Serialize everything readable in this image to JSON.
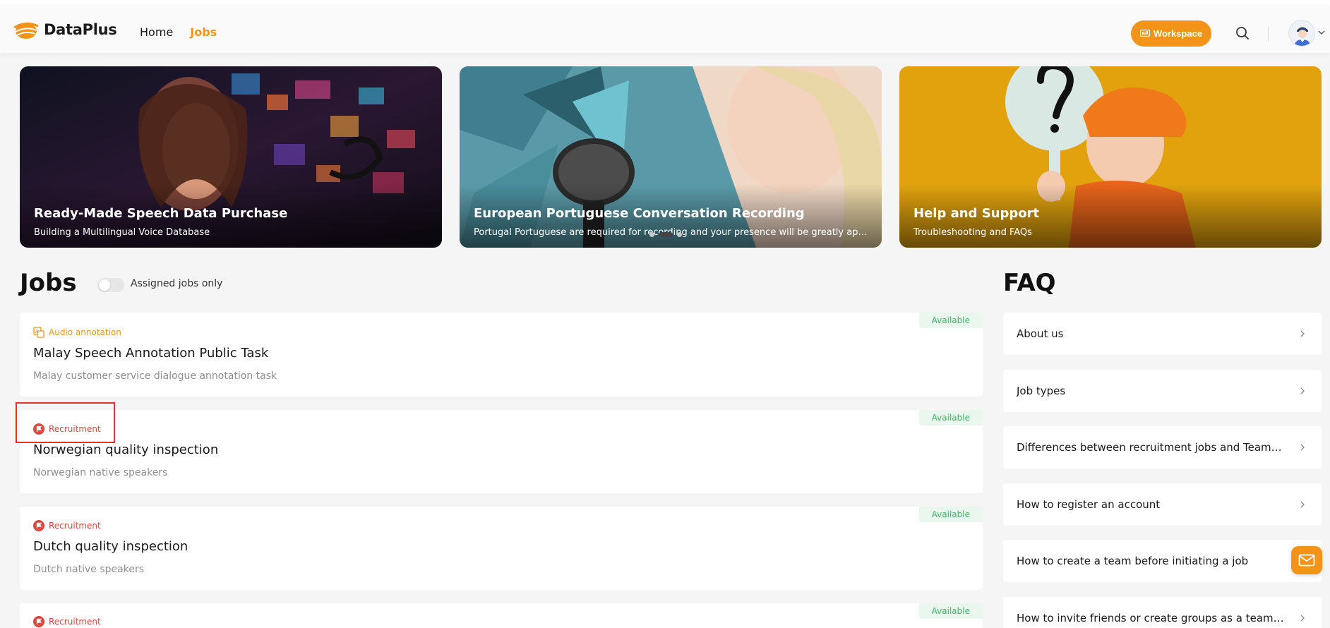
{
  "brand": {
    "name": "DataPlus"
  },
  "nav": {
    "home": "Home",
    "jobs": "Jobs"
  },
  "header": {
    "workspace_label": "Workspace"
  },
  "banners": [
    {
      "title": "Ready-Made Speech Data Purchase",
      "subtitle": "Building a Multilingual Voice Database"
    },
    {
      "title": "European Portuguese Conversation Recording",
      "subtitle": "Portugal Portuguese are required for recording and your presence will be greatly appreciated"
    },
    {
      "title": "Help and Support",
      "subtitle": "Troubleshooting and FAQs"
    }
  ],
  "jobs": {
    "title": "Jobs",
    "toggle_label": "Assigned jobs only",
    "items": [
      {
        "type": "Audio annotation",
        "title": "Malay Speech Annotation Public Task",
        "desc": "Malay customer service dialogue annotation task",
        "status": "Available"
      },
      {
        "type": "Recruitment",
        "title": "Norwegian quality inspection",
        "desc": "Norwegian native speakers",
        "status": "Available"
      },
      {
        "type": "Recruitment",
        "title": "Dutch quality inspection",
        "desc": "Dutch native speakers",
        "status": "Available"
      },
      {
        "type": "Recruitment",
        "title": "",
        "desc": "",
        "status": "Available"
      }
    ]
  },
  "faq": {
    "title": "FAQ",
    "items": [
      "About us",
      "Job types",
      "Differences between recruitment jobs and Team jobs",
      "How to register an account",
      "How to create a team before initiating a job",
      "How to invite friends or create groups as a team leader"
    ]
  },
  "colors": {
    "accent": "#f39418",
    "recruit": "#e5463c",
    "available": "#3bb665"
  }
}
